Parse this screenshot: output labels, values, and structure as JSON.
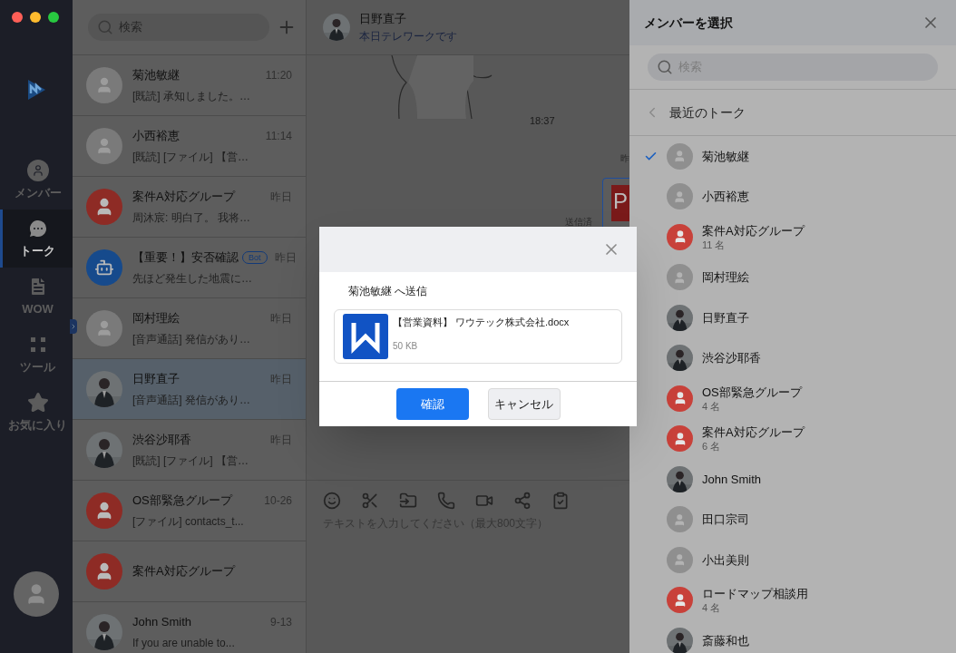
{
  "rail": {
    "nav": [
      {
        "kind": "member",
        "label": "メンバー",
        "selected": false
      },
      {
        "kind": "talk",
        "label": "トーク",
        "selected": true
      },
      {
        "kind": "wow",
        "label": "WOW",
        "selected": false
      },
      {
        "kind": "tool",
        "label": "ツール",
        "selected": false
      },
      {
        "kind": "favorite",
        "label": "お気に入り",
        "selected": false
      }
    ]
  },
  "conversations": {
    "search": {
      "placeholder": "検索"
    },
    "items": [
      {
        "kind": "person",
        "name": "菊池敏継",
        "time": "11:20",
        "preview": "[既読] 承知しました。…",
        "selected": false
      },
      {
        "kind": "person",
        "name": "小西裕恵",
        "time": "11:14",
        "preview": "[既読] [ファイル] 【営…",
        "selected": false
      },
      {
        "kind": "group",
        "name": "案件A対応グループ",
        "time": "昨日",
        "preview": "周沐宸: 明白了。 我将…",
        "selected": false
      },
      {
        "kind": "bot",
        "name": "【重要！】安否確認",
        "badge": "Bot",
        "time": "昨日",
        "preview": "先ほど発生した地震に…",
        "selected": false
      },
      {
        "kind": "person",
        "name": "岡村理絵",
        "time": "昨日",
        "preview": "[音声通話] 発信があり…",
        "selected": false
      },
      {
        "name": "日野直子",
        "time": "昨日",
        "preview": "[音声通話] 発信があり…",
        "selected": true
      },
      {
        "name": "渋谷沙耶香",
        "time": "昨日",
        "preview": "[既読] [ファイル] 【営…",
        "selected": false
      },
      {
        "kind": "group",
        "name": "OS部緊急グループ",
        "time": "10-26",
        "preview": "[ファイル] contacts_t...",
        "selected": false
      },
      {
        "kind": "group",
        "name": "案件A対応グループ",
        "selected": false
      },
      {
        "name": "John Smith",
        "time": "9-13",
        "preview": "If you are unable to...",
        "selected": false
      }
    ]
  },
  "chat": {
    "name": "日野直子",
    "status": "本日テレワークです",
    "time": "18:37",
    "date_cut": "昨",
    "sent": "送信済",
    "file_letter": "P",
    "input": {
      "placeholder": "テキストを入力してください（最大800文字）"
    }
  },
  "member_panel": {
    "title": "メンバーを選択",
    "search": {
      "placeholder": "検索"
    },
    "section": "最近のトーク",
    "members": [
      {
        "kind": "person",
        "name": "菊池敏継",
        "checked": true
      },
      {
        "kind": "person",
        "name": "小西裕恵",
        "checked": false
      },
      {
        "kind": "group",
        "name": "案件A対応グループ",
        "count": "11 名",
        "checked": false
      },
      {
        "kind": "person",
        "name": "岡村理絵",
        "checked": false
      },
      {
        "name": "日野直子",
        "checked": false
      },
      {
        "name": "渋谷沙耶香",
        "checked": false
      },
      {
        "kind": "group",
        "name": "OS部緊急グループ",
        "count": "4 名",
        "checked": false
      },
      {
        "kind": "group",
        "name": "案件A対応グループ",
        "count": "6 名",
        "checked": false
      },
      {
        "name": "John Smith",
        "checked": false
      },
      {
        "kind": "person",
        "name": "田口宗司",
        "checked": false
      },
      {
        "kind": "person",
        "name": "小出美則",
        "checked": false
      },
      {
        "kind": "group",
        "name": "ロードマップ相談用",
        "count": "4 名",
        "checked": false
      },
      {
        "name": "斎藤和也",
        "checked": false
      }
    ]
  },
  "dialog": {
    "recipient": "菊池敏継 へ送信",
    "file": {
      "name": "【営業資料】 ワウテック株式会社.docx",
      "size": "50 KB"
    },
    "buttons": [
      {
        "kind": "primary",
        "label": "確認"
      },
      {
        "kind": "secondary",
        "label": "キャンセル"
      }
    ]
  }
}
